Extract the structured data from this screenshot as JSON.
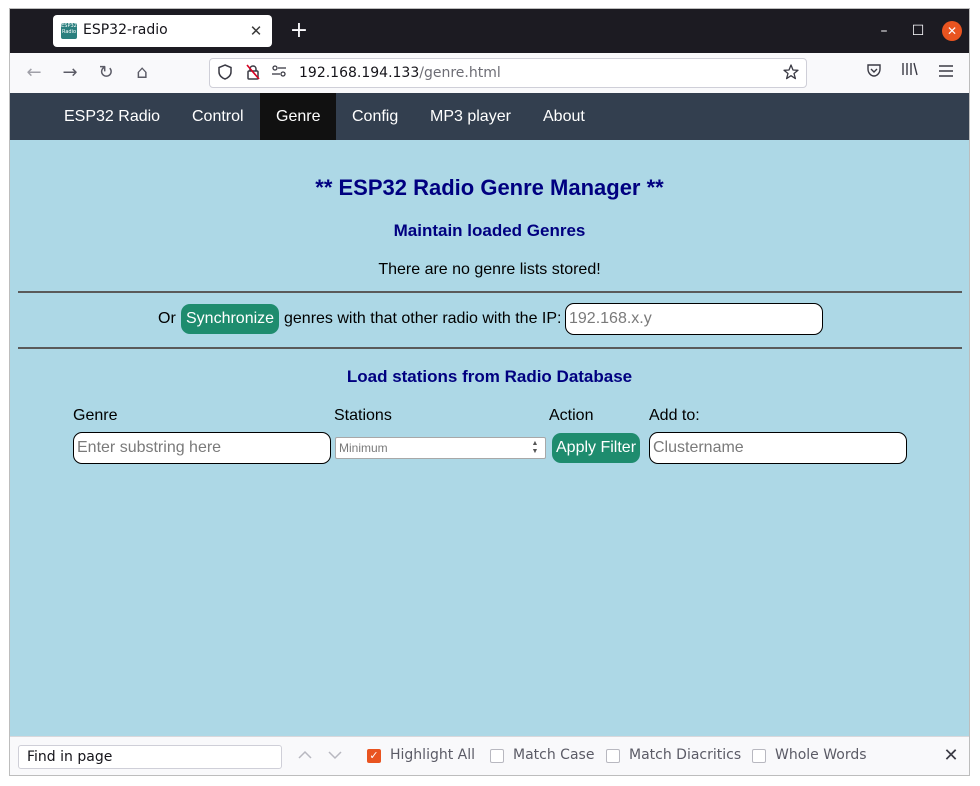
{
  "browser": {
    "tab": {
      "title": "ESP32-radio",
      "favicon_text": "ESP32 Radio",
      "close": "✕"
    },
    "new_tab": "+",
    "window_controls": {
      "minimize": "–",
      "maximize": "☐",
      "close": "✕"
    },
    "nav": {
      "back": "←",
      "forward": "→",
      "reload": "↻",
      "home": "⌂"
    },
    "url": {
      "host": "192.168.194.133",
      "path": "/genre.html"
    },
    "icons": {
      "shield": "shield-icon",
      "lock": "lock-icon",
      "permissions": "permissions-icon",
      "star": "bookmark-star-icon",
      "pocket": "pocket-icon",
      "library": "library-icon",
      "menu": "hamburger-menu-icon"
    }
  },
  "page": {
    "menu": [
      "ESP32 Radio",
      "Control",
      "Genre",
      "Config",
      "MP3 player",
      "About"
    ],
    "active_menu": "Genre",
    "title": "** ESP32 Radio Genre Manager **",
    "maintain_title": "Maintain loaded Genres",
    "no_genres": "There are no genre lists stored!",
    "sync": {
      "prefix": "Or",
      "button": "Synchronize",
      "text": "genres with that other radio with the IP:",
      "ip_placeholder": "192.168.x.y"
    },
    "load_title": "Load stations from Radio Database",
    "columns": {
      "genre": "Genre",
      "stations": "Stations",
      "action": "Action",
      "add_to": "Add to:"
    },
    "genre_placeholder": "Enter substring here",
    "stations_placeholder": "Minimum",
    "apply_button": "Apply Filter",
    "cluster_placeholder": "Clustername",
    "colors": {
      "background": "#add8e6",
      "menu_bg": "#333f4f",
      "menu_active": "#111111",
      "heading": "#000080",
      "button": "#1e8c6e"
    }
  },
  "findbar": {
    "placeholder": "Find in page",
    "highlight_all": "Highlight All",
    "match_case": "Match Case",
    "match_diacritics": "Match Diacritics",
    "whole_words": "Whole Words",
    "highlight_checked": true,
    "close": "✕"
  }
}
